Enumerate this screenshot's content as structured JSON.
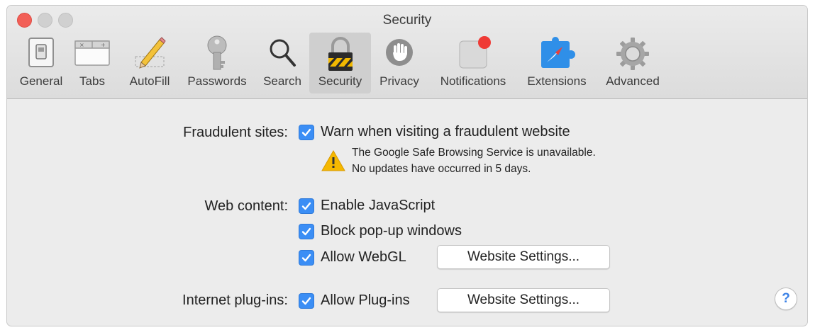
{
  "window": {
    "title": "Security"
  },
  "toolbar": {
    "tabs": [
      {
        "label": "General",
        "icon": "switch-icon"
      },
      {
        "label": "Tabs",
        "icon": "tabs-icon"
      },
      {
        "label": "AutoFill",
        "icon": "pencil-icon"
      },
      {
        "label": "Passwords",
        "icon": "key-icon"
      },
      {
        "label": "Search",
        "icon": "magnifier-icon"
      },
      {
        "label": "Security",
        "icon": "padlock-icon",
        "active": true
      },
      {
        "label": "Privacy",
        "icon": "hand-icon"
      },
      {
        "label": "Notifications",
        "icon": "notification-icon"
      },
      {
        "label": "Extensions",
        "icon": "puzzle-icon"
      },
      {
        "label": "Advanced",
        "icon": "gear-icon"
      }
    ]
  },
  "fraudulent": {
    "label": "Fraudulent sites:",
    "checkbox": "Warn when visiting a fraudulent website",
    "checked": true,
    "warning_line1": "The Google Safe Browsing Service is unavailable.",
    "warning_line2": "No updates have occurred in 5 days."
  },
  "web_content": {
    "label": "Web content:",
    "javascript": "Enable JavaScript",
    "popups": "Block pop-up windows",
    "webgl": "Allow WebGL",
    "webgl_button": "Website Settings..."
  },
  "plugins": {
    "label": "Internet plug-ins:",
    "allow": "Allow Plug-ins",
    "button": "Website Settings..."
  },
  "help": {
    "label": "?"
  },
  "colors": {
    "accent": "#3b8ef5",
    "close": "#f25f57",
    "warning": "#f5b800"
  }
}
